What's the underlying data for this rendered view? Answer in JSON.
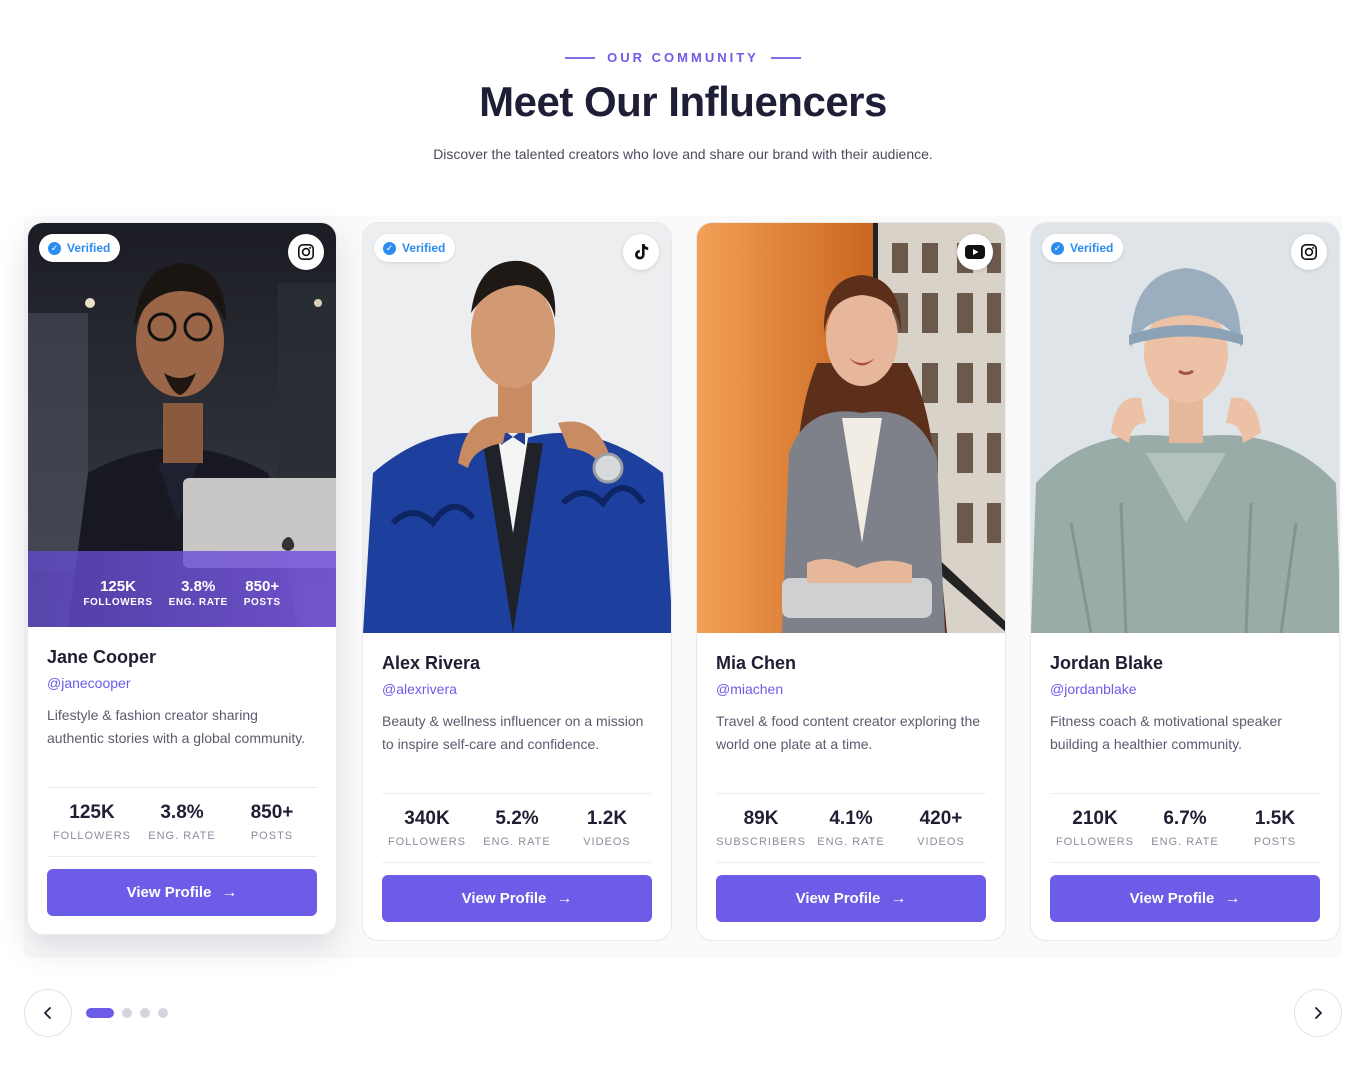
{
  "header": {
    "eyebrow": "OUR COMMUNITY",
    "title": "Meet Our Influencers",
    "subtitle": "Discover the talented creators who love and share our brand with their audience."
  },
  "badge_label": "Verified",
  "button_label": "View Profile",
  "cards": [
    {
      "name": "Jane Cooper",
      "handle": "@janecooper",
      "description": "Lifestyle & fashion creator sharing authentic stories with a global community.",
      "platform": "instagram-icon",
      "verified": true,
      "stats": [
        {
          "value": "125K",
          "label": "FOLLOWERS"
        },
        {
          "value": "3.8%",
          "label": "ENG. RATE"
        },
        {
          "value": "850+",
          "label": "POSTS"
        }
      ]
    },
    {
      "name": "Alex Rivera",
      "handle": "@alexrivera",
      "description": "Beauty & wellness influencer on a mission to inspire self-care and confidence.",
      "platform": "tiktok-icon",
      "verified": true,
      "stats": [
        {
          "value": "340K",
          "label": "FOLLOWERS"
        },
        {
          "value": "5.2%",
          "label": "ENG. RATE"
        },
        {
          "value": "1.2K",
          "label": "VIDEOS"
        }
      ]
    },
    {
      "name": "Mia Chen",
      "handle": "@miachen",
      "description": "Travel & food content creator exploring the world one plate at a time.",
      "platform": "youtube-icon",
      "verified": false,
      "stats": [
        {
          "value": "89K",
          "label": "SUBSCRIBERS"
        },
        {
          "value": "4.1%",
          "label": "ENG. RATE"
        },
        {
          "value": "420+",
          "label": "VIDEOS"
        }
      ]
    },
    {
      "name": "Jordan Blake",
      "handle": "@jordanblake",
      "description": "Fitness coach & motivational speaker building a healthier community.",
      "platform": "instagram-icon",
      "verified": true,
      "stats": [
        {
          "value": "210K",
          "label": "FOLLOWERS"
        },
        {
          "value": "6.7%",
          "label": "ENG. RATE"
        },
        {
          "value": "1.5K",
          "label": "POSTS"
        }
      ]
    }
  ],
  "pagination": {
    "total": 4,
    "active": 0
  },
  "colors": {
    "accent": "#6c5ce7",
    "verified": "#2d8cf0",
    "heading": "#1e1f36"
  }
}
